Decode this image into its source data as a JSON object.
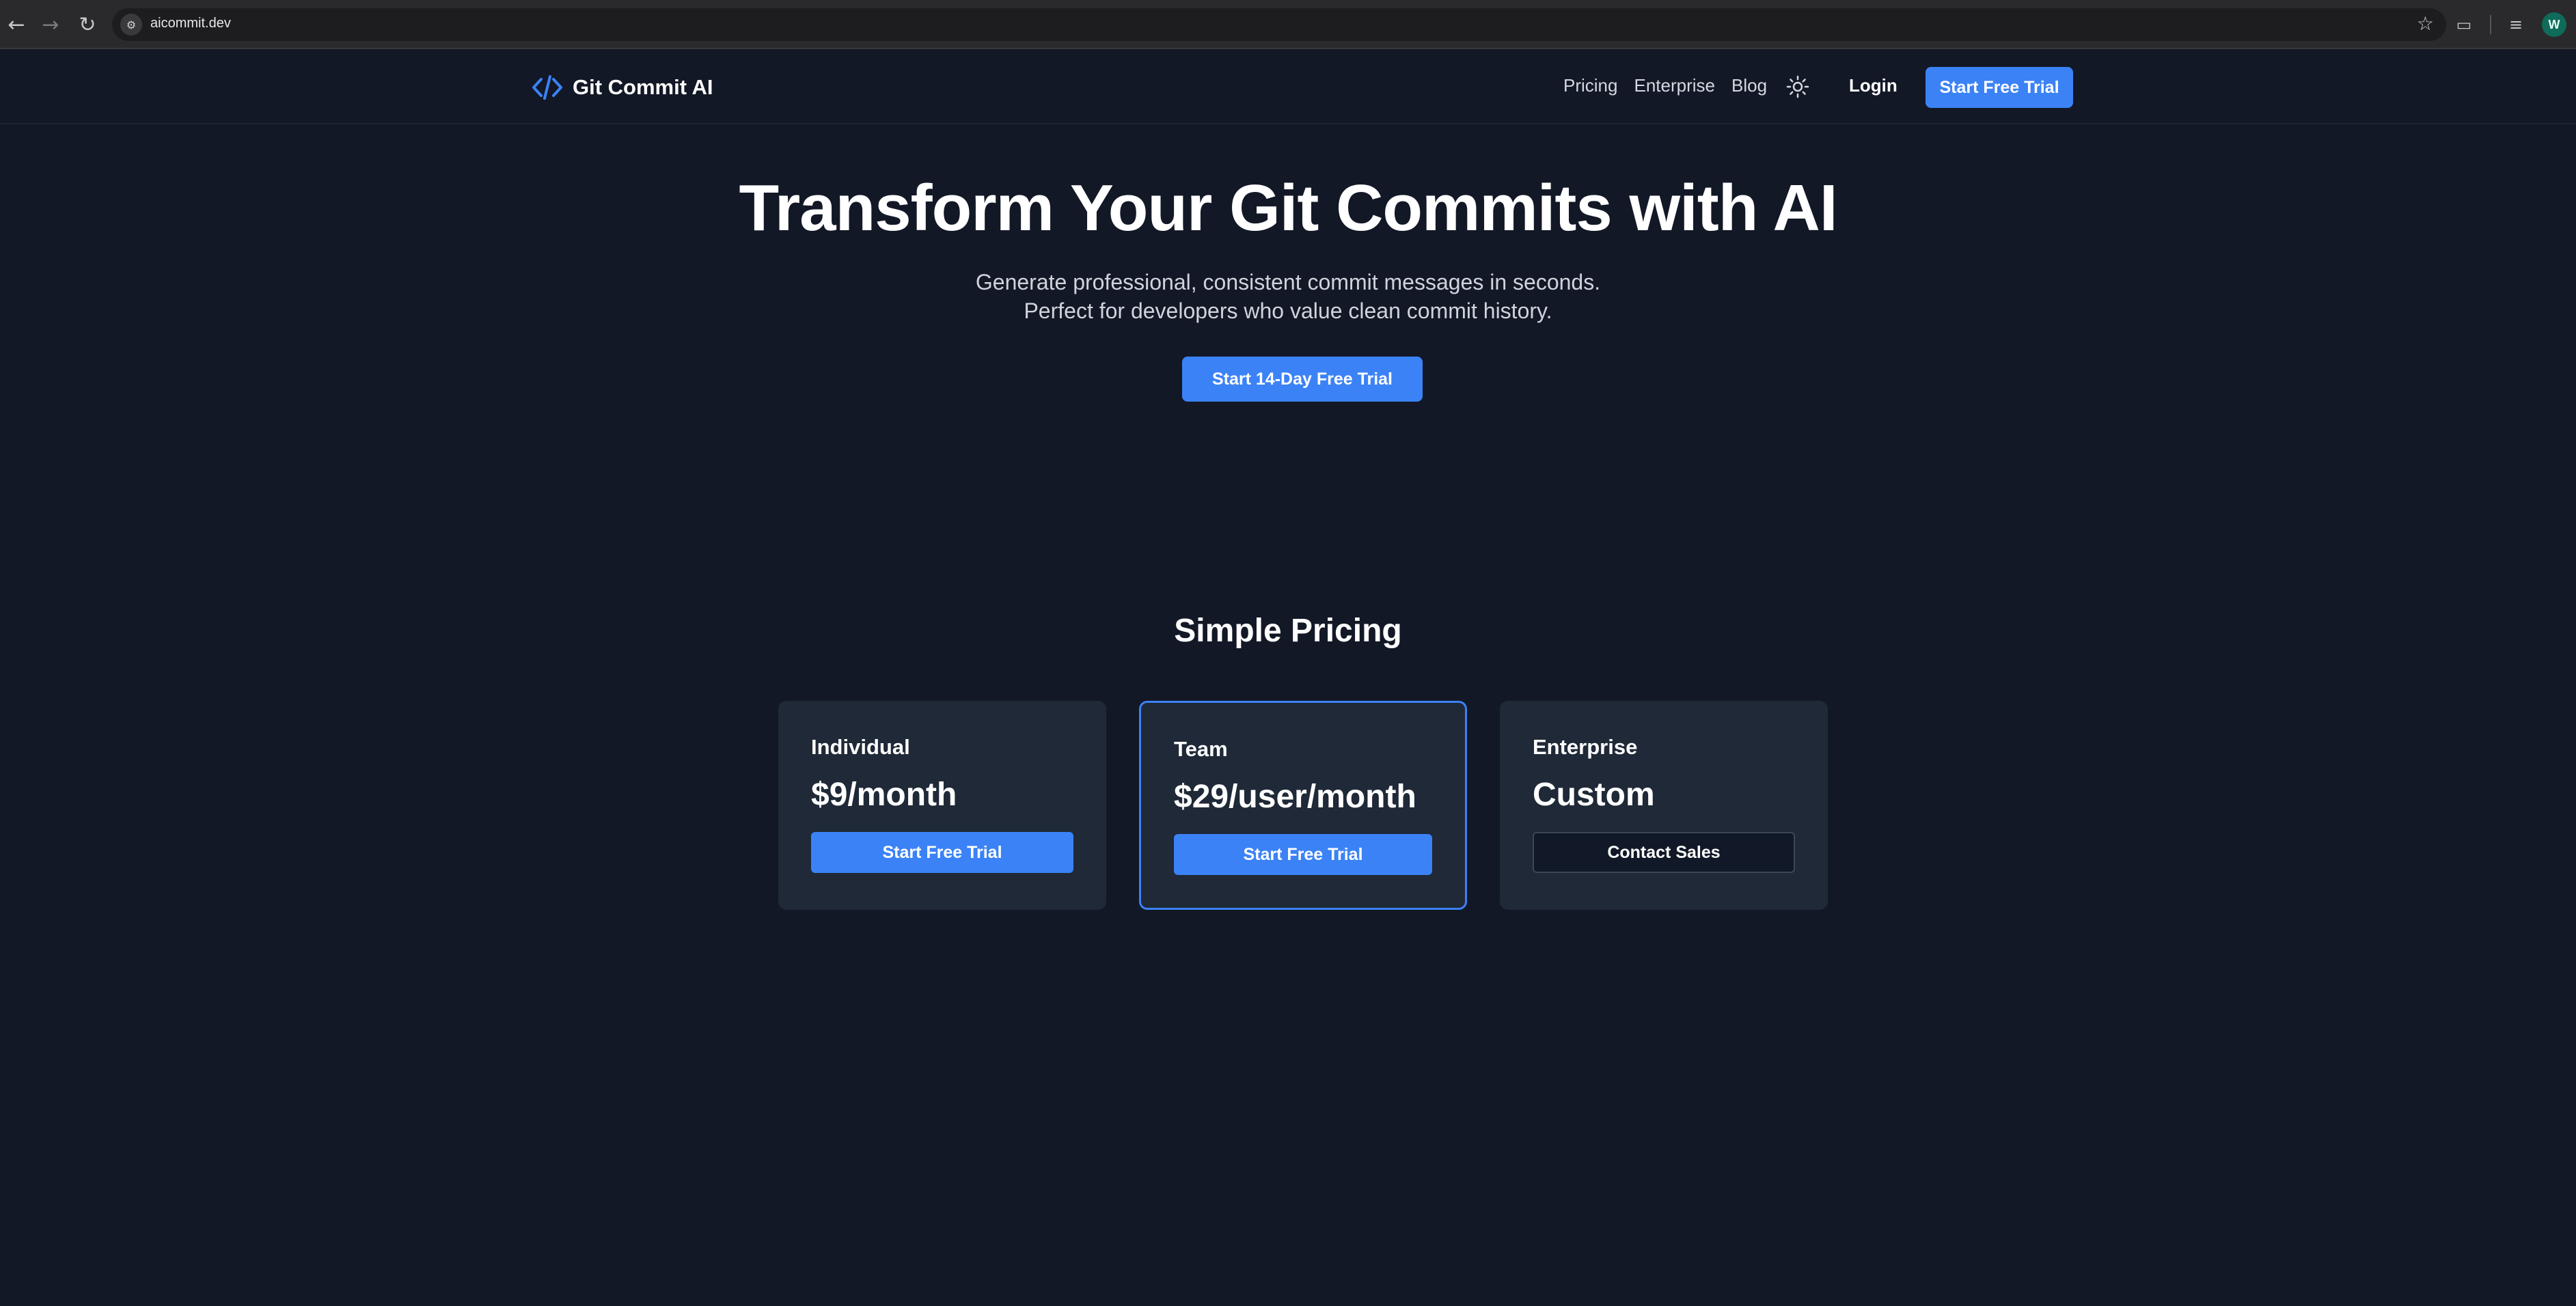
{
  "browser": {
    "url": "aicommit.dev",
    "back_icon": "arrow-left-icon",
    "forward_icon": "arrow-right-icon",
    "reload_icon": "reload-icon",
    "profile_initial": "W"
  },
  "header": {
    "brand": "Git Commit AI",
    "nav": [
      "Pricing",
      "Enterprise",
      "Blog"
    ],
    "login": "Login",
    "cta": "Start Free Trial"
  },
  "hero": {
    "title": "Transform Your Git Commits with AI",
    "subtitle_line1": "Generate professional, consistent commit messages in seconds.",
    "subtitle_line2": "Perfect for developers who value clean commit history.",
    "cta": "Start 14-Day Free Trial"
  },
  "pricing": {
    "title": "Simple Pricing",
    "plans": [
      {
        "name": "Individual",
        "price": "$9/month",
        "button": "Start Free Trial",
        "featured": false
      },
      {
        "name": "Team",
        "price": "$29/user/month",
        "button": "Start Free Trial",
        "featured": true
      },
      {
        "name": "Enterprise",
        "price": "Custom",
        "button": "Contact Sales",
        "featured": false
      }
    ]
  },
  "colors": {
    "background": "#121826",
    "card": "#1f2937",
    "accent": "#3b82f6"
  }
}
